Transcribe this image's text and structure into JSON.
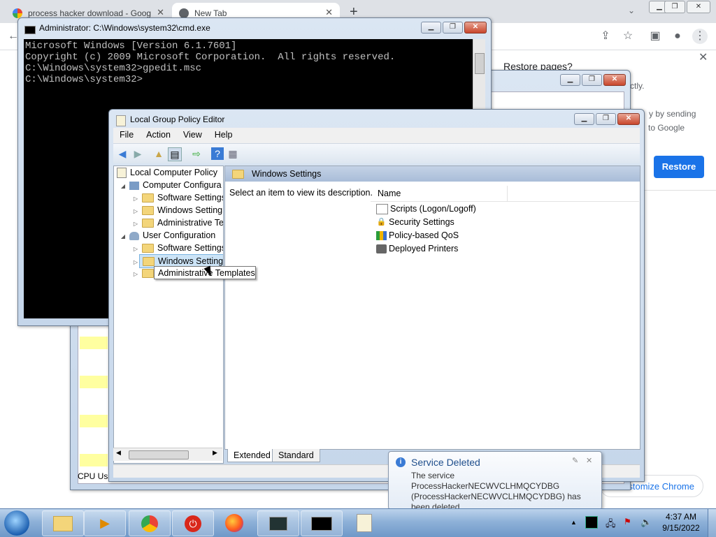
{
  "chrome": {
    "tabs": [
      {
        "title": "process hacker download - Goog",
        "active": false
      },
      {
        "title": "New Tab",
        "active": true
      }
    ],
    "new_tab_symbol": "+",
    "restore_popup": {
      "title": "Restore pages?",
      "text_fragment_1": "ctly.",
      "text_fragment_2": "y by sending",
      "text_fragment_3": "to Google",
      "restore_label": "Restore"
    },
    "customize_label": "Customize Chrome"
  },
  "cmd": {
    "title": "Administrator: C:\\Windows\\system32\\cmd.exe",
    "lines": [
      "Microsoft Windows [Version 6.1.7601]",
      "Copyright (c) 2009 Microsoft Corporation.  All rights reserved.",
      "",
      "C:\\Windows\\system32>gpedit.msc",
      "",
      "C:\\Windows\\system32>"
    ]
  },
  "taskmgr": {
    "status_fragment": "CPU Usa"
  },
  "gpedit": {
    "title": "Local Group Policy Editor",
    "menu": [
      "File",
      "Action",
      "View",
      "Help"
    ],
    "tree": {
      "root": "Local Computer Policy",
      "computer_config": "Computer Configura",
      "cc_children": [
        "Software Settings",
        "Windows Setting",
        "Administrative Te"
      ],
      "user_config": "User Configuration",
      "uc_children": [
        "Software Settings",
        "Windows Setting",
        "Administrative Templates"
      ]
    },
    "right_header": "Windows Settings",
    "description": "Select an item to view its description.",
    "column_name": "Name",
    "items": [
      {
        "name": "Scripts (Logon/Logoff)",
        "icon": "script-icon"
      },
      {
        "name": "Security Settings",
        "icon": "security-icon"
      },
      {
        "name": "Policy-based QoS",
        "icon": "chart-icon"
      },
      {
        "name": "Deployed Printers",
        "icon": "printer-icon"
      }
    ],
    "tabs": [
      "Extended",
      "Standard"
    ]
  },
  "tooltip": "Administrative Templates",
  "balloon": {
    "title": "Service Deleted",
    "message": "The service ProcessHackerNECWVCLHMQCYDBG (ProcessHackerNECWVCLHMQCYDBG) has been deleted."
  },
  "taskbar": {
    "time": "4:37 AM",
    "date": "9/15/2022"
  }
}
